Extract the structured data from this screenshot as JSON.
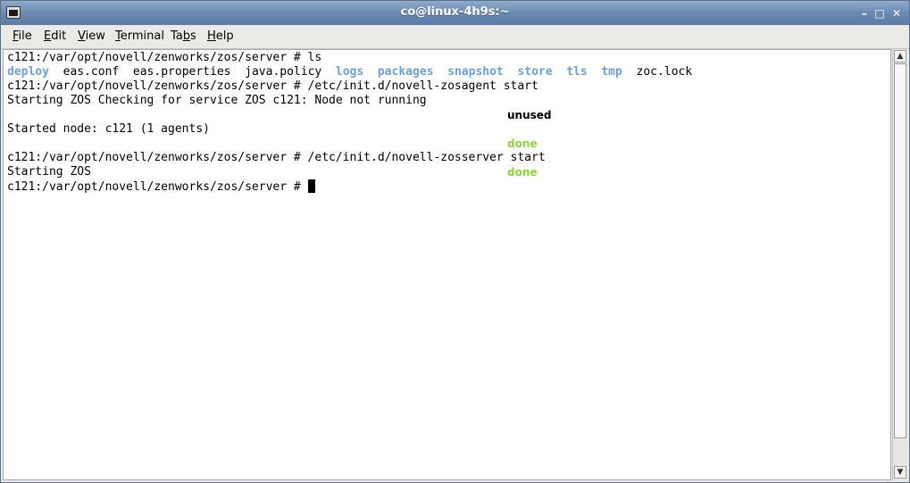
{
  "window": {
    "title": "co@linux-4h9s:~",
    "controls": {
      "minimize": "–",
      "maximize": "□",
      "close": "✕"
    }
  },
  "menu": {
    "file": {
      "accel": "F",
      "rest": "ile"
    },
    "edit": {
      "accel": "E",
      "rest": "dit"
    },
    "view": {
      "accel": "V",
      "rest": "iew"
    },
    "terminal": {
      "accel": "T",
      "rest": "erminal"
    },
    "tabs": {
      "pre": "Ta",
      "accel": "b",
      "rest": "s"
    },
    "help": {
      "accel": "H",
      "rest": "elp"
    }
  },
  "terminal": {
    "prompt": "c121:/var/opt/novell/zenworks/zos/server # ",
    "lines": {
      "l1_cmd": "ls",
      "ls": {
        "deploy": "deploy",
        "eas_conf": "eas.conf",
        "eas_properties": "eas.properties",
        "java_policy": "java.policy",
        "logs": "logs",
        "packages": "packages",
        "snapshot": "snapshot",
        "store": "store",
        "tls": "tls",
        "tmp": "tmp",
        "zoc_lock": "zoc.lock"
      },
      "l3_cmd": "/etc/init.d/novell-zosagent start",
      "l4": "Starting ZOS Checking for service ZOS c121: Node not running",
      "status_unused": "unused",
      "l6": "Started node: c121 (1 agents)",
      "status_done1": "done",
      "l8_cmd": "/etc/init.d/novell-zosserver start",
      "l9": "Starting ZOS",
      "status_done2": "done"
    }
  },
  "colors": {
    "directory": "#6f9fd0",
    "done": "#8cd23a",
    "titlebar": "#6b8ab2"
  }
}
